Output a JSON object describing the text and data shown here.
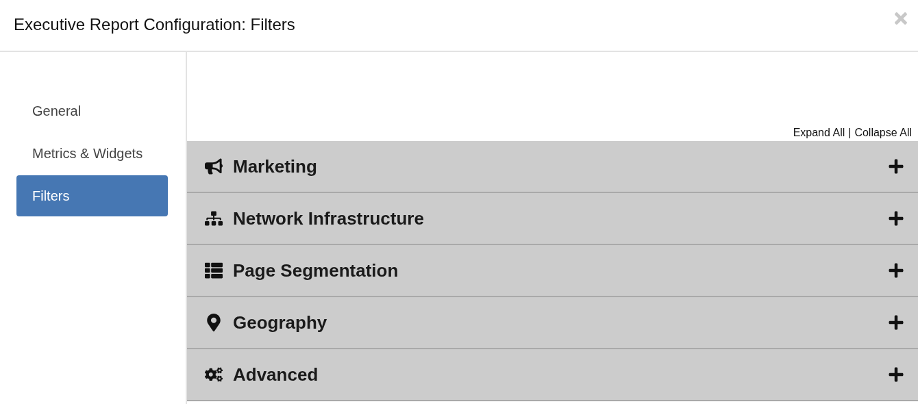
{
  "dialog": {
    "title": "Executive Report Configuration: Filters"
  },
  "sidebar": {
    "items": [
      {
        "label": "General",
        "selected": false
      },
      {
        "label": "Metrics & Widgets",
        "selected": false
      },
      {
        "label": "Filters",
        "selected": true
      }
    ]
  },
  "toolbar": {
    "expand_all": "Expand All",
    "separator": "|",
    "collapse_all": "Collapse All"
  },
  "panels": [
    {
      "kind": "bullhorn",
      "title": "Marketing",
      "expanded": false
    },
    {
      "kind": "sitemap",
      "title": "Network Infrastructure",
      "expanded": false
    },
    {
      "kind": "list",
      "title": "Page Segmentation",
      "expanded": false
    },
    {
      "kind": "marker",
      "title": "Geography",
      "expanded": false
    },
    {
      "kind": "cogs",
      "title": "Advanced",
      "expanded": false
    }
  ]
}
